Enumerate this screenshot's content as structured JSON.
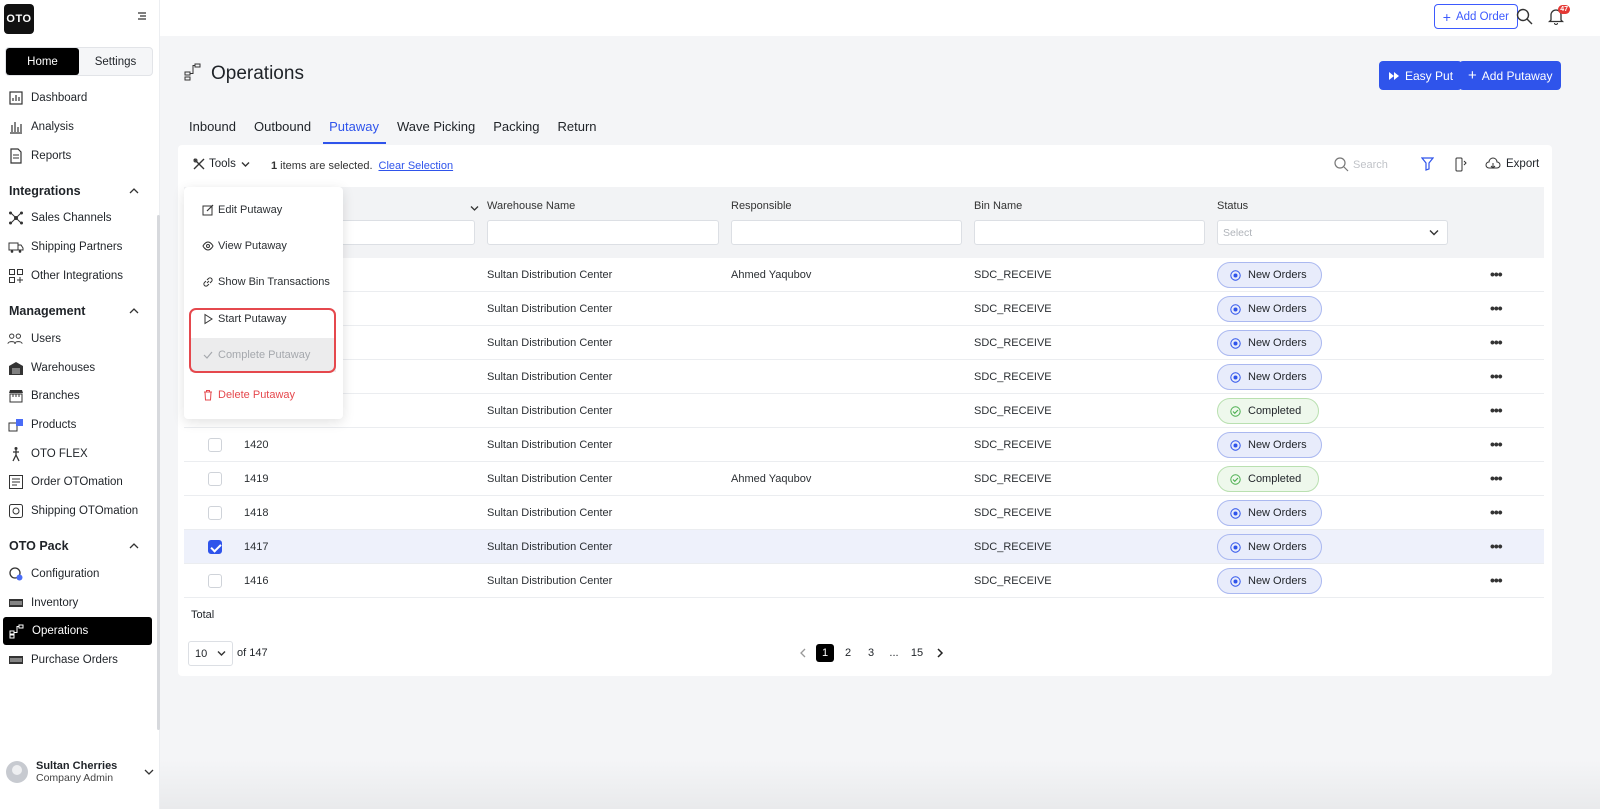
{
  "app": {
    "logo": "OTO"
  },
  "sidebar": {
    "seg_home": "Home",
    "seg_settings": "Settings",
    "items": [
      {
        "label": "Dashboard",
        "icon": "dashboard-icon"
      },
      {
        "label": "Analysis",
        "icon": "analysis-icon"
      },
      {
        "label": "Reports",
        "icon": "reports-icon"
      }
    ],
    "integrations": {
      "title": "Integrations",
      "items": [
        "Sales Channels",
        "Shipping Partners",
        "Other Integrations"
      ]
    },
    "management": {
      "title": "Management",
      "items": [
        "Users",
        "Warehouses",
        "Branches",
        "Products",
        "OTO FLEX",
        "Order OTOmation",
        "Shipping OTOmation"
      ]
    },
    "otopack": {
      "title": "OTO Pack",
      "items": [
        "Configuration",
        "Inventory",
        "Operations",
        "Purchase Orders"
      ]
    },
    "user": {
      "name": "Sultan Cherries",
      "role": "Company Admin"
    }
  },
  "topbar": {
    "add_order": "Add Order",
    "notif_count": "47"
  },
  "page": {
    "title": "Operations",
    "easy_put": "Easy Put",
    "add_putaway": "Add Putaway",
    "tabs": [
      "Inbound",
      "Outbound",
      "Putaway",
      "Wave Picking",
      "Packing",
      "Return"
    ],
    "active_tab": "Putaway"
  },
  "toolbar": {
    "tools": "Tools",
    "selected_count": "1",
    "selected_text": " items are selected.",
    "clear_selection": "Clear Selection",
    "search_placeholder": "Search",
    "export": "Export"
  },
  "table": {
    "columns": [
      "Warehouse Name",
      "Responsible",
      "Bin Name",
      "Status"
    ],
    "status_placeholder": "Select",
    "rows": [
      {
        "id": "",
        "warehouse": "Sultan Distribution Center",
        "responsible": "Ahmed Yaqubov",
        "bin": "SDC_RECEIVE",
        "status": "New Orders",
        "checked": false
      },
      {
        "id": "",
        "warehouse": "Sultan Distribution Center",
        "responsible": "",
        "bin": "SDC_RECEIVE",
        "status": "New Orders",
        "checked": false
      },
      {
        "id": "",
        "warehouse": "Sultan Distribution Center",
        "responsible": "",
        "bin": "SDC_RECEIVE",
        "status": "New Orders",
        "checked": false
      },
      {
        "id": "",
        "warehouse": "Sultan Distribution Center",
        "responsible": "",
        "bin": "SDC_RECEIVE",
        "status": "New Orders",
        "checked": false
      },
      {
        "id": "",
        "warehouse": "Sultan Distribution Center",
        "responsible": "",
        "bin": "SDC_RECEIVE",
        "status": "Completed",
        "checked": false
      },
      {
        "id": "1420",
        "warehouse": "Sultan Distribution Center",
        "responsible": "",
        "bin": "SDC_RECEIVE",
        "status": "New Orders",
        "checked": false
      },
      {
        "id": "1419",
        "warehouse": "Sultan Distribution Center",
        "responsible": "Ahmed Yaqubov",
        "bin": "SDC_RECEIVE",
        "status": "Completed",
        "checked": false
      },
      {
        "id": "1418",
        "warehouse": "Sultan Distribution Center",
        "responsible": "",
        "bin": "SDC_RECEIVE",
        "status": "New Orders",
        "checked": false
      },
      {
        "id": "1417",
        "warehouse": "Sultan Distribution Center",
        "responsible": "",
        "bin": "SDC_RECEIVE",
        "status": "New Orders",
        "checked": true
      },
      {
        "id": "1416",
        "warehouse": "Sultan Distribution Center",
        "responsible": "",
        "bin": "SDC_RECEIVE",
        "status": "New Orders",
        "checked": false
      }
    ],
    "total_label": "Total"
  },
  "pagination": {
    "page_size": "10",
    "of_total": "of 147",
    "pages": [
      "1",
      "2",
      "3",
      "...",
      "15"
    ],
    "current": "1"
  },
  "menu": {
    "edit": "Edit Putaway",
    "view": "View Putaway",
    "bin_tx": "Show Bin Transactions",
    "start": "Start Putaway",
    "complete": "Complete Putaway",
    "delete": "Delete Putaway"
  },
  "colors": {
    "accent": "#2f54eb",
    "danger": "#e5484d",
    "new_badge": "#e8ecfb",
    "done_badge": "#eef8ec"
  }
}
